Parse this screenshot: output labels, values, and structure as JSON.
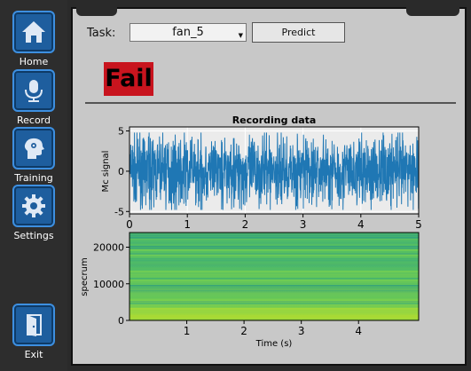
{
  "sidebar": {
    "items": [
      {
        "label": "Home",
        "icon": "home-icon"
      },
      {
        "label": "Record",
        "icon": "microphone-icon"
      },
      {
        "label": "Training",
        "icon": "brain-icon"
      },
      {
        "label": "Settings",
        "icon": "gear-icon"
      }
    ],
    "exit": {
      "label": "Exit",
      "icon": "exit-door-icon"
    }
  },
  "task": {
    "label": "Task:",
    "value": "fan_5"
  },
  "predict": {
    "label": "Predict"
  },
  "result": {
    "label": "Fail",
    "color": "#c8141e"
  },
  "colors": {
    "accent": "#1e5e9e",
    "signal": "#1f77b4"
  },
  "chart_data": [
    {
      "type": "line",
      "title": "Recording data",
      "ylabel": "Mc signal",
      "xlim": [
        0,
        5
      ],
      "ylim": [
        -5,
        5
      ],
      "xticks": [
        "0",
        "1",
        "2",
        "3",
        "4",
        "5"
      ],
      "yticks": [
        "5",
        "0",
        "-5"
      ],
      "grid": true,
      "series": [
        {
          "description": "dense noise signal approx ±3 with peaks to ±4.5",
          "amplitude": 3
        }
      ]
    },
    {
      "type": "heatmap",
      "ylabel": "specrum",
      "xlabel": "Time (s)",
      "xticks": [
        "1",
        "2",
        "3",
        "4"
      ],
      "yticks": [
        "20000",
        "10000",
        "0"
      ],
      "ylim": [
        0,
        24000
      ],
      "colormap": "viridis"
    }
  ]
}
